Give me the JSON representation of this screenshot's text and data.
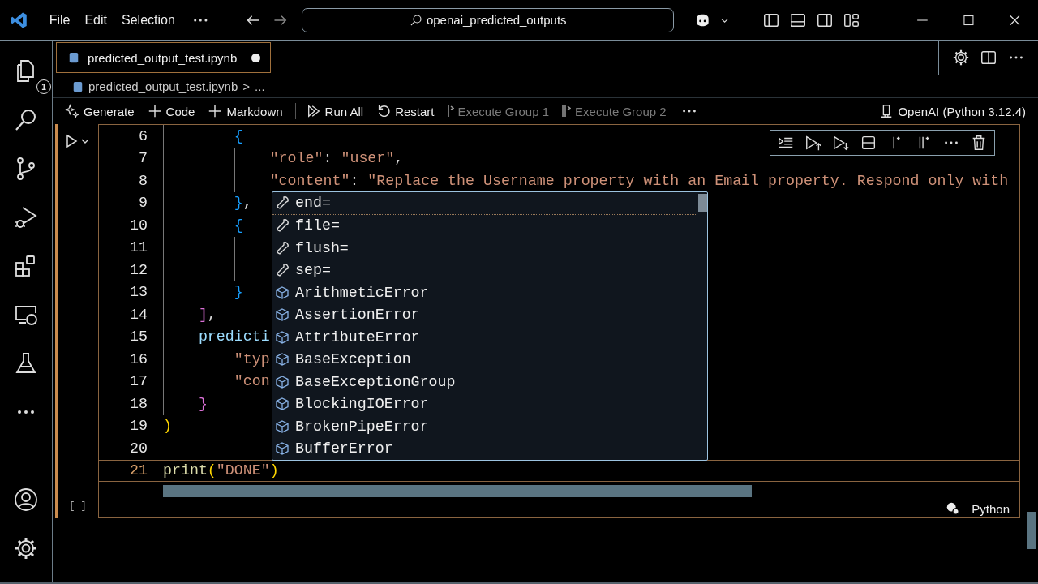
{
  "titlebar": {
    "menus": [
      "File",
      "Edit",
      "Selection"
    ],
    "search": "openai_predicted_outputs"
  },
  "activity_bar": {
    "top": [
      {
        "kind": "explorer",
        "badge": "1",
        "selected": false
      },
      {
        "kind": "search",
        "selected": false
      },
      {
        "kind": "source-control",
        "selected": false
      },
      {
        "kind": "run-debug",
        "selected": false
      },
      {
        "kind": "extensions",
        "selected": false
      },
      {
        "kind": "remote",
        "selected": false
      },
      {
        "kind": "testing",
        "selected": false
      },
      {
        "kind": "more",
        "selected": false
      }
    ],
    "bottom": [
      {
        "kind": "account"
      },
      {
        "kind": "settings"
      }
    ]
  },
  "tabs": [
    {
      "label": "predicted_output_test.ipynb",
      "selected": true,
      "dirty": true
    }
  ],
  "breadcrumb": {
    "file": "predicted_output_test.ipynb",
    "separator": ">",
    "rest": "..."
  },
  "toolbar": {
    "items": [
      {
        "kind": "generate",
        "label": "Generate",
        "disabled": false
      },
      {
        "kind": "add",
        "label": "Code",
        "disabled": false
      },
      {
        "kind": "add",
        "label": "Markdown",
        "disabled": false
      },
      {
        "kind": "run-all",
        "label": "Run All",
        "disabled": false
      },
      {
        "kind": "restart",
        "label": "Restart",
        "disabled": false
      },
      {
        "kind": "group",
        "label": "Execute Group 1",
        "disabled": true
      },
      {
        "kind": "group2",
        "label": "Execute Group 2",
        "disabled": true
      }
    ],
    "kernel": "OpenAI (Python 3.12.4)"
  },
  "cell": {
    "execution_count": "[ ]",
    "language": "Python",
    "lines": [
      {
        "number": "6",
        "current": false,
        "tokens": [
          {
            "text": "        {",
            "kind": "br3"
          }
        ]
      },
      {
        "number": "7",
        "current": false,
        "tokens": [
          {
            "text": "            \"role\"",
            "kind": "str"
          },
          {
            "text": ": ",
            "kind": "punct"
          },
          {
            "text": "\"user\"",
            "kind": "str"
          },
          {
            "text": ",",
            "kind": "punct"
          }
        ]
      },
      {
        "number": "8",
        "current": false,
        "tokens": [
          {
            "text": "            \"content\"",
            "kind": "str"
          },
          {
            "text": ": ",
            "kind": "punct"
          },
          {
            "text": "\"Replace the Username property with an Email property. Respond only with",
            "kind": "str"
          }
        ]
      },
      {
        "number": "9",
        "current": false,
        "tokens": [
          {
            "text": "        }",
            "kind": "br3"
          },
          {
            "text": ",",
            "kind": "punct"
          }
        ]
      },
      {
        "number": "10",
        "current": false,
        "tokens": [
          {
            "text": "        {",
            "kind": "br3"
          }
        ]
      },
      {
        "number": "11",
        "current": false
      },
      {
        "number": "12",
        "current": false
      },
      {
        "number": "13",
        "current": false,
        "tokens": [
          {
            "text": "        }",
            "kind": "br3"
          }
        ]
      },
      {
        "number": "14",
        "current": false,
        "tokens": [
          {
            "text": "    ]",
            "kind": "br2"
          },
          {
            "text": ",",
            "kind": "punct"
          }
        ]
      },
      {
        "number": "15",
        "current": false,
        "tokens": [
          {
            "text": "    predicti",
            "kind": "var"
          }
        ]
      },
      {
        "number": "16",
        "current": false,
        "tokens": [
          {
            "text": "        \"typ",
            "kind": "str"
          }
        ]
      },
      {
        "number": "17",
        "current": false,
        "tokens": [
          {
            "text": "        \"con",
            "kind": "str"
          }
        ]
      },
      {
        "number": "18",
        "current": false,
        "tokens": [
          {
            "text": "    }",
            "kind": "br2"
          }
        ]
      },
      {
        "number": "19",
        "current": false,
        "tokens": [
          {
            "text": ")",
            "kind": "br1"
          }
        ]
      },
      {
        "number": "20",
        "current": false
      },
      {
        "number": "21",
        "current": true,
        "tokens": [
          {
            "text": "print",
            "kind": "fn"
          },
          {
            "text": "(",
            "kind": "br1"
          },
          {
            "text": "\"DONE\"",
            "kind": "str"
          },
          {
            "text": ")",
            "kind": "br1"
          }
        ]
      }
    ]
  },
  "suggestions": [
    {
      "label": "end=",
      "kind": "parameter",
      "selected": true
    },
    {
      "label": "file=",
      "kind": "parameter",
      "selected": false
    },
    {
      "label": "flush=",
      "kind": "parameter",
      "selected": false
    },
    {
      "label": "sep=",
      "kind": "parameter",
      "selected": false
    },
    {
      "label": "ArithmeticError",
      "kind": "class",
      "selected": false
    },
    {
      "label": "AssertionError",
      "kind": "class",
      "selected": false
    },
    {
      "label": "AttributeError",
      "kind": "class",
      "selected": false
    },
    {
      "label": "BaseException",
      "kind": "class",
      "selected": false
    },
    {
      "label": "BaseExceptionGroup",
      "kind": "class",
      "selected": false
    },
    {
      "label": "BlockingIOError",
      "kind": "class",
      "selected": false
    },
    {
      "label": "BrokenPipeError",
      "kind": "class",
      "selected": false
    },
    {
      "label": "BufferError",
      "kind": "class",
      "selected": false
    }
  ]
}
